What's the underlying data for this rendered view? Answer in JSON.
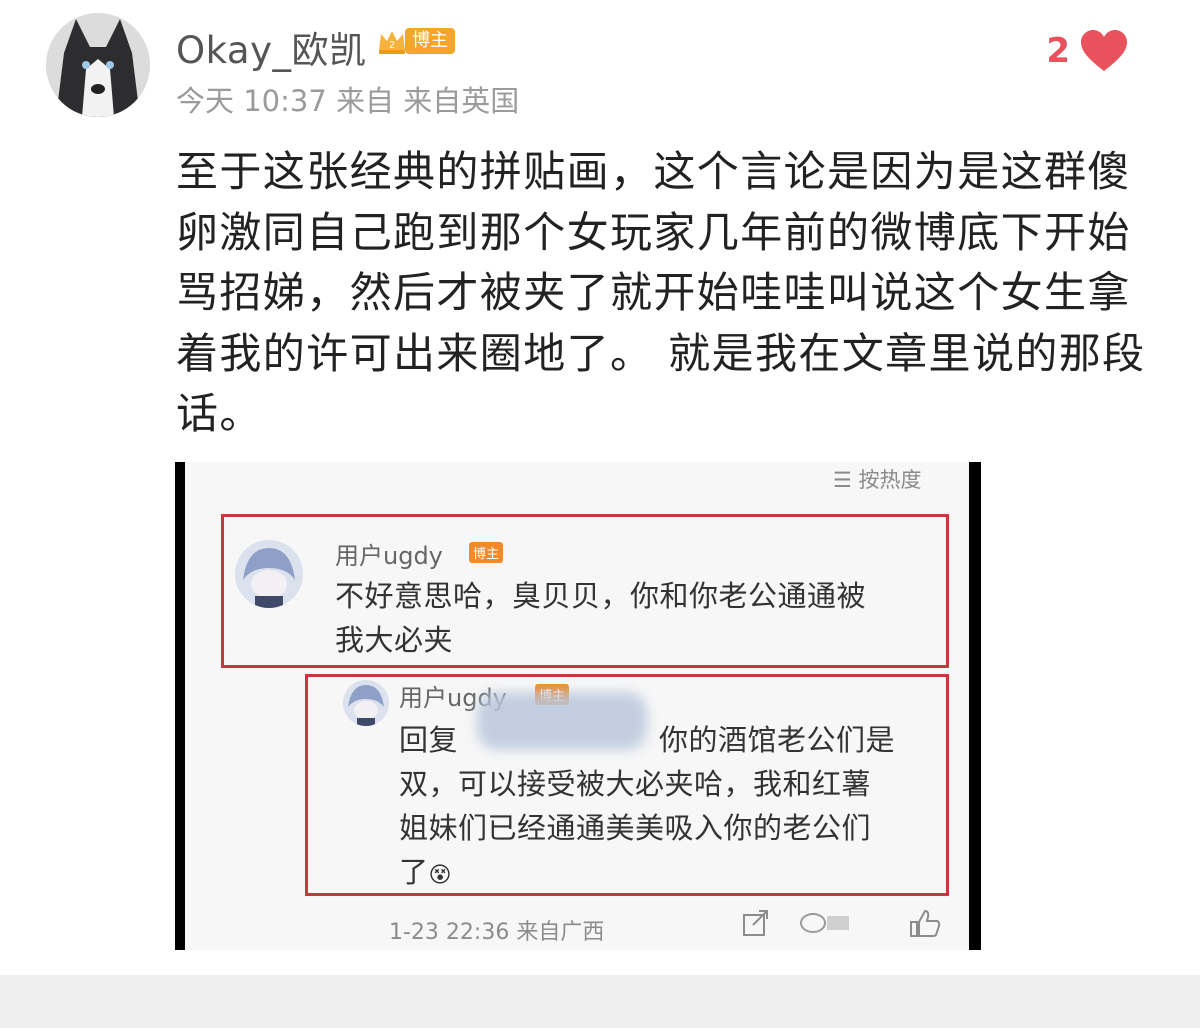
{
  "post": {
    "username": "Okay_欧凯",
    "badge_label": "博主",
    "meta": "今天 10:37 来自 来自英国",
    "like_count": "2",
    "text": "至于这张经典的拼贴画，这个言论是因为是这群傻卵激同自己跑到那个女玩家几年前的微博底下开始骂招娣，然后才被夹了就开始哇哇叫说这个女生拿着我的许可出来圈地了。 就是我在文章里说的那段话。"
  },
  "embedded": {
    "sort_label": "☰ 按热度",
    "comment": {
      "username": "用户ugdy",
      "tag": "博主",
      "line1": "不好意思哈，臭贝贝，你和你老公通通被",
      "line2": "我大必夹"
    },
    "reply": {
      "username": "用户ugdy",
      "tag": "博主",
      "line1_prefix": "回复",
      "line1_suffix": "你的酒馆老公们是",
      "line2": "双，可以接受被大必夹哈，我和红薯",
      "line3": "姐妹们已经通通美美吸入你的老公们",
      "line4": "了",
      "emoji": "😵"
    },
    "meta": "1-23 22:36 来自广西"
  },
  "colors": {
    "like": "#e8525c",
    "badge": "#f4a62a",
    "highlight_box": "#c9373e"
  },
  "icons": [
    "husky-avatar",
    "crown-icon",
    "heart-icon",
    "share-icon",
    "comment-icon",
    "like-icon"
  ]
}
